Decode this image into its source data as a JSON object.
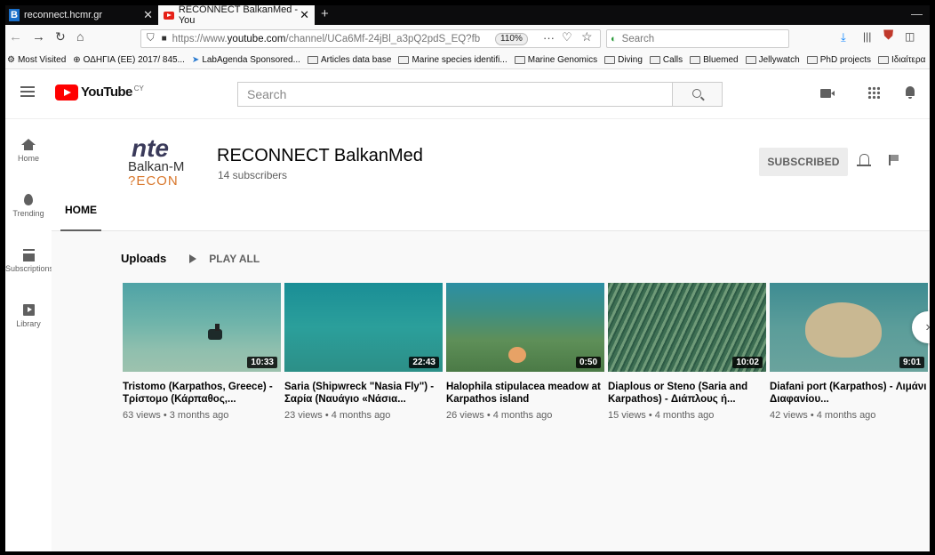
{
  "browser": {
    "tabs": [
      {
        "title": "reconnect.hcmr.gr",
        "active": false
      },
      {
        "title": "RECONNECT BalkanMed - You",
        "active": true
      }
    ],
    "url_prefix": "https://www.",
    "url_domain": "youtube.com",
    "url_rest": "/channel/UCa6Mf-24jBl_a3pQ2pdS_EQ?fb",
    "zoom": "110%",
    "search_placeholder": "Search",
    "bookmarks": [
      {
        "label": "Most Visited",
        "icon": "gear-icon"
      },
      {
        "label": "ΟΔΗΓΙΑ (ΕΕ) 2017/ 845...",
        "icon": "globe-icon"
      },
      {
        "label": "LabAgenda Sponsored...",
        "icon": "bird-icon"
      },
      {
        "label": "Articles data base",
        "icon": "folder-icon"
      },
      {
        "label": "Marine species identifi...",
        "icon": "folder-icon"
      },
      {
        "label": "Marine Genomics",
        "icon": "folder-icon"
      },
      {
        "label": "Diving",
        "icon": "folder-icon"
      },
      {
        "label": "Calls",
        "icon": "folder-icon"
      },
      {
        "label": "Bluemed",
        "icon": "folder-icon"
      },
      {
        "label": "Jellywatch",
        "icon": "folder-icon"
      },
      {
        "label": "PhD projects",
        "icon": "folder-icon"
      },
      {
        "label": "Ιδιαίτερα",
        "icon": "folder-icon"
      }
    ]
  },
  "youtube": {
    "logo_text": "YouTube",
    "country": "CY",
    "search_placeholder": "Search",
    "guide": [
      {
        "label": "Home",
        "icon": "home-icon"
      },
      {
        "label": "Trending",
        "icon": "fire-icon"
      },
      {
        "label": "Subscriptions",
        "icon": "subscriptions-icon"
      },
      {
        "label": "Library",
        "icon": "library-icon"
      }
    ]
  },
  "channel": {
    "avatar_top": "nte",
    "avatar_mid": "Balkan-M",
    "avatar_bot": "?ECON",
    "title": "RECONNECT BalkanMed",
    "subscribers": "14 subscribers",
    "subscribe_label": "SUBSCRIBED",
    "tab_home": "HOME"
  },
  "uploads": {
    "title": "Uploads",
    "play_all": "PLAY ALL",
    "videos": [
      {
        "title": "Tristomo (Karpathos, Greece) - Τρίστομο (Κάρπαθος,...",
        "duration": "10:33",
        "meta": "63 views • 3 months ago"
      },
      {
        "title": "Saria (Shipwreck \"Nasia Fly\") - Σαρία (Ναυάγιο «Νάσια...",
        "duration": "22:43",
        "meta": "23 views • 4 months ago"
      },
      {
        "title": "Halophila stipulacea meadow at Karpathos island",
        "duration": "0:50",
        "meta": "26 views • 4 months ago"
      },
      {
        "title": "Diaplous or Steno (Saria and Karpathos) - Διάπλους ή...",
        "duration": "10:02",
        "meta": "15 views • 4 months ago"
      },
      {
        "title": "Diafani port (Karpathos) - Λιμάνι Διαφανίου...",
        "duration": "9:01",
        "meta": "42 views • 4 months ago"
      }
    ]
  },
  "colors": {
    "brand_red": "#ff0000",
    "tab_bar": "#0c0c0d"
  }
}
